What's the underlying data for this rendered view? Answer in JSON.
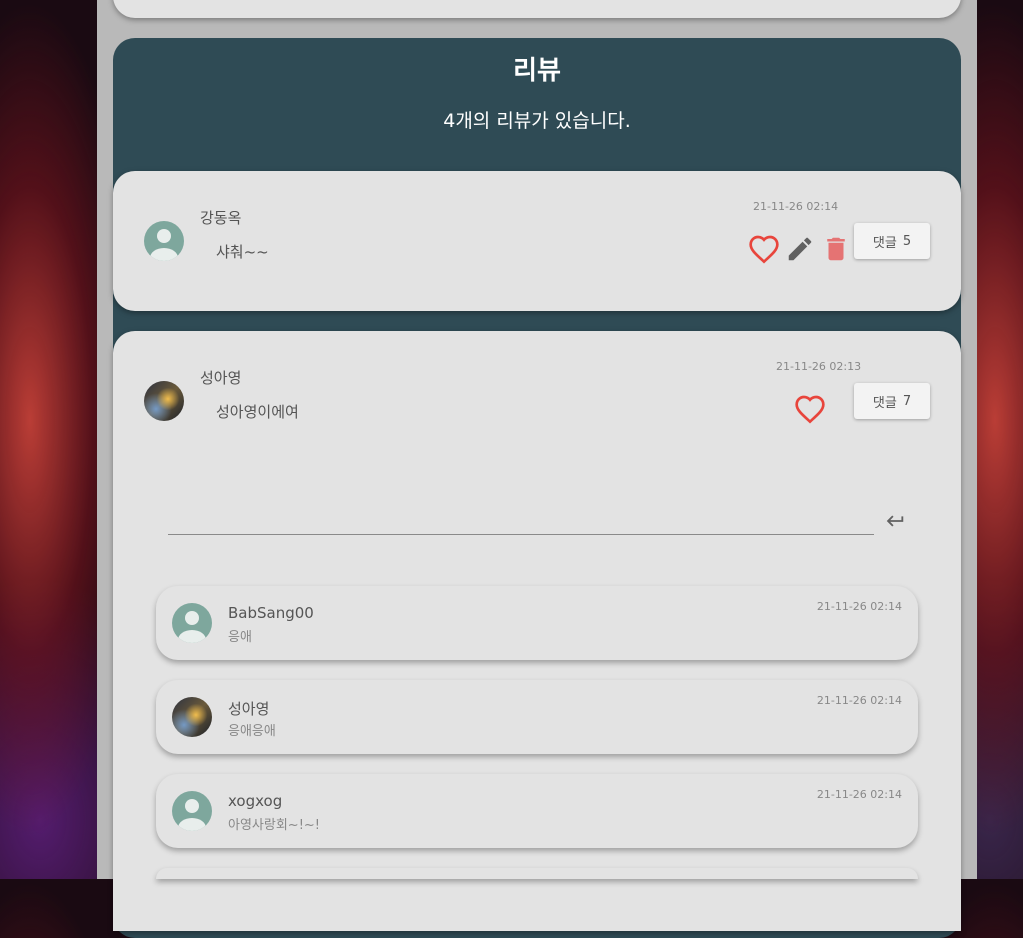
{
  "section": {
    "title": "리뷰",
    "subtitle": "4개의 리뷰가 있습니다."
  },
  "reviews": [
    {
      "author": "강동옥",
      "content": "샤춰~~",
      "timestamp": "21-11-26 02:14",
      "avatar": "default-avatar",
      "reply_label": "댓글",
      "reply_count": "5"
    },
    {
      "author": "성아영",
      "content": "성아영이에여",
      "timestamp": "21-11-26 02:13",
      "avatar": "photo-avatar",
      "reply_label": "댓글",
      "reply_count": "7"
    }
  ],
  "reply_input": {
    "value": "",
    "placeholder": ""
  },
  "comments": [
    {
      "author": "BabSang00",
      "text": "응애",
      "timestamp": "21-11-26 02:14",
      "avatar": "default-avatar"
    },
    {
      "author": "성아영",
      "text": "응애응애",
      "timestamp": "21-11-26 02:14",
      "avatar": "photo-avatar"
    },
    {
      "author": "xogxog",
      "text": "아영사랑회~!~!",
      "timestamp": "21-11-26 02:14",
      "avatar": "default-avatar"
    }
  ],
  "colors": {
    "section_bg": "#2f4b55",
    "card_bg": "#e3e3e3",
    "heart": "#e8453c",
    "delete": "#e57373",
    "edit": "#616161"
  },
  "icons": [
    "heart-outline-icon",
    "pencil-icon",
    "trash-icon",
    "enter-icon"
  ]
}
